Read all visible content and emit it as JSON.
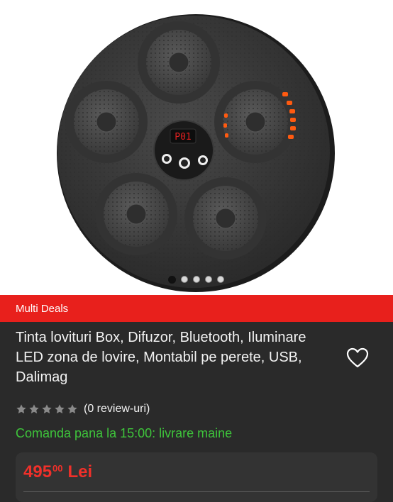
{
  "gallery": {
    "display": {
      "text": "P01"
    },
    "slides": 5,
    "active_slide": 1
  },
  "badge": {
    "label": "Multi Deals"
  },
  "product": {
    "title": "Tinta lovituri Box, Difuzor, Bluetooth, Iluminare LED zona de lovire, Montabil pe perete, USB, Dalimag"
  },
  "rating": {
    "stars": 0,
    "max_stars": 5,
    "reviews_text": "(0 review-uri)"
  },
  "delivery": {
    "text": "Comanda pana la 15:00: livrare maine"
  },
  "price": {
    "integer": "495",
    "decimals": "00",
    "currency": "Lei"
  },
  "colors": {
    "badge_bg": "#e8201c",
    "price": "#f0302a",
    "delivery": "#3ec43b",
    "background": "#2a2a2a"
  }
}
